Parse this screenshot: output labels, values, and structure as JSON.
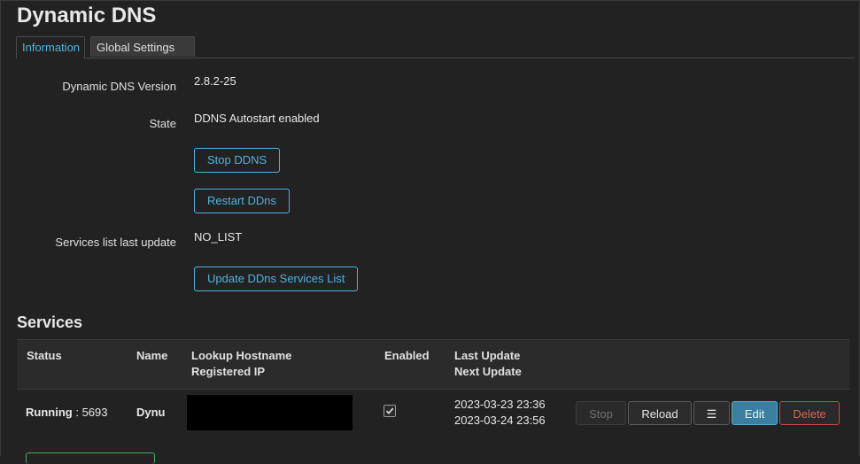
{
  "page": {
    "title": "Dynamic DNS"
  },
  "tabs": [
    {
      "label": "Information",
      "active": true
    },
    {
      "label": "Global Settings",
      "active": false
    }
  ],
  "info": {
    "version_label": "Dynamic DNS Version",
    "version_value": "2.8.2-25",
    "state_label": "State",
    "state_value": "DDNS Autostart enabled",
    "stop_button": "Stop DDNS",
    "restart_button": "Restart DDns",
    "services_update_label": "Services list last update",
    "services_update_value": "NO_LIST",
    "update_list_button": "Update DDns Services List"
  },
  "services": {
    "heading": "Services",
    "columns": {
      "status": "Status",
      "name": "Name",
      "lookup_hostname": "Lookup Hostname",
      "registered_ip": "Registered IP",
      "enabled": "Enabled",
      "last_update": "Last Update",
      "next_update": "Next Update"
    },
    "rows": [
      {
        "status_label": "Running",
        "status_sep": " : ",
        "pid": "5693",
        "name": "Dynu",
        "enabled": true,
        "last_update": "2023-03-23 23:36",
        "next_update": "2023-03-24 23:56",
        "actions": {
          "stop": "Stop",
          "reload": "Reload",
          "menu": "☰",
          "edit": "Edit",
          "delete": "Delete"
        }
      }
    ]
  },
  "colors": {
    "accent": "#4fb3e0",
    "danger": "#e0605f",
    "edit_bg": "#3a7fa0",
    "background": "#222222"
  }
}
